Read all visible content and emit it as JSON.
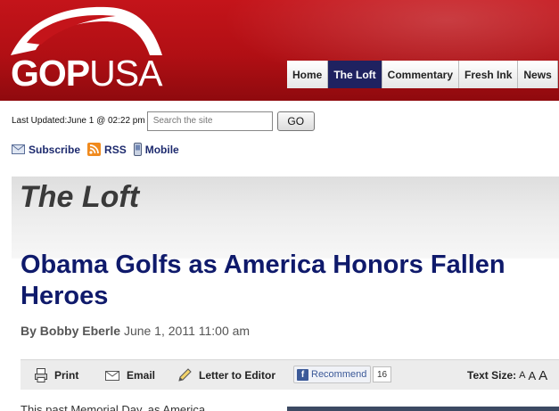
{
  "brand": {
    "gop": "GOP",
    "usa": "USA"
  },
  "nav": {
    "items": [
      {
        "label": "Home",
        "active": false
      },
      {
        "label": "The Loft",
        "active": true
      },
      {
        "label": "Commentary",
        "active": false
      },
      {
        "label": "Fresh Ink",
        "active": false
      },
      {
        "label": "News",
        "active": false
      }
    ]
  },
  "utility": {
    "updated": "Last Updated:June 1 @ 02:22 pm",
    "search_placeholder": "Search the site",
    "go_label": "GO"
  },
  "subscribe": {
    "subscribe_label": "Subscribe",
    "rss_label": "RSS",
    "mobile_label": "Mobile"
  },
  "section": {
    "title": "The Loft"
  },
  "article": {
    "headline": "Obama Golfs as America Honors Fallen Heroes",
    "by": "By",
    "author": "Bobby Eberle",
    "date": "June 1, 2011 11:00 am",
    "body_start": "This past Memorial Day, as America"
  },
  "tools": {
    "print_label": "Print",
    "email_label": "Email",
    "letter_label": "Letter to Editor",
    "fb_logo": "f",
    "recommend_label": "Recommend",
    "recommend_count": "16",
    "text_size_label": "Text Size:",
    "size_small": "A",
    "size_medium": "A",
    "size_large": "A"
  },
  "colors": {
    "header_red": "#b10f14",
    "nav_active": "#1f2260",
    "headline_blue": "#0f1a6b",
    "link_blue": "#1d2a6e"
  }
}
